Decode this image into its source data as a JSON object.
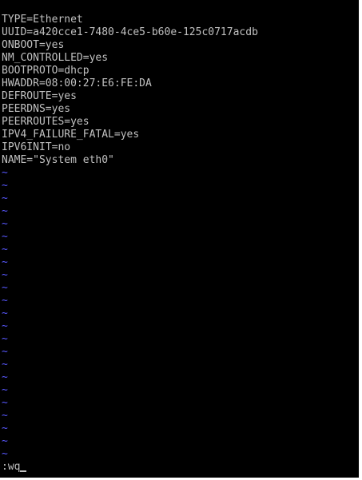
{
  "file_lines": [
    "TYPE=Ethernet",
    "UUID=a420cce1-7480-4ce5-b60e-125c0717acdb",
    "ONBOOT=yes",
    "NM_CONTROLLED=yes",
    "BOOTPROTO=dhcp",
    "HWADDR=08:00:27:E6:FE:DA",
    "DEFROUTE=yes",
    "PEERDNS=yes",
    "PEERROUTES=yes",
    "IPV4_FAILURE_FATAL=yes",
    "IPV6INIT=no",
    "NAME=\"System eth0\""
  ],
  "empty_line_marker": "~",
  "command": ":wq",
  "colors": {
    "background": "#000000",
    "text": "#c0c0c0",
    "tilde": "#5858ff"
  }
}
